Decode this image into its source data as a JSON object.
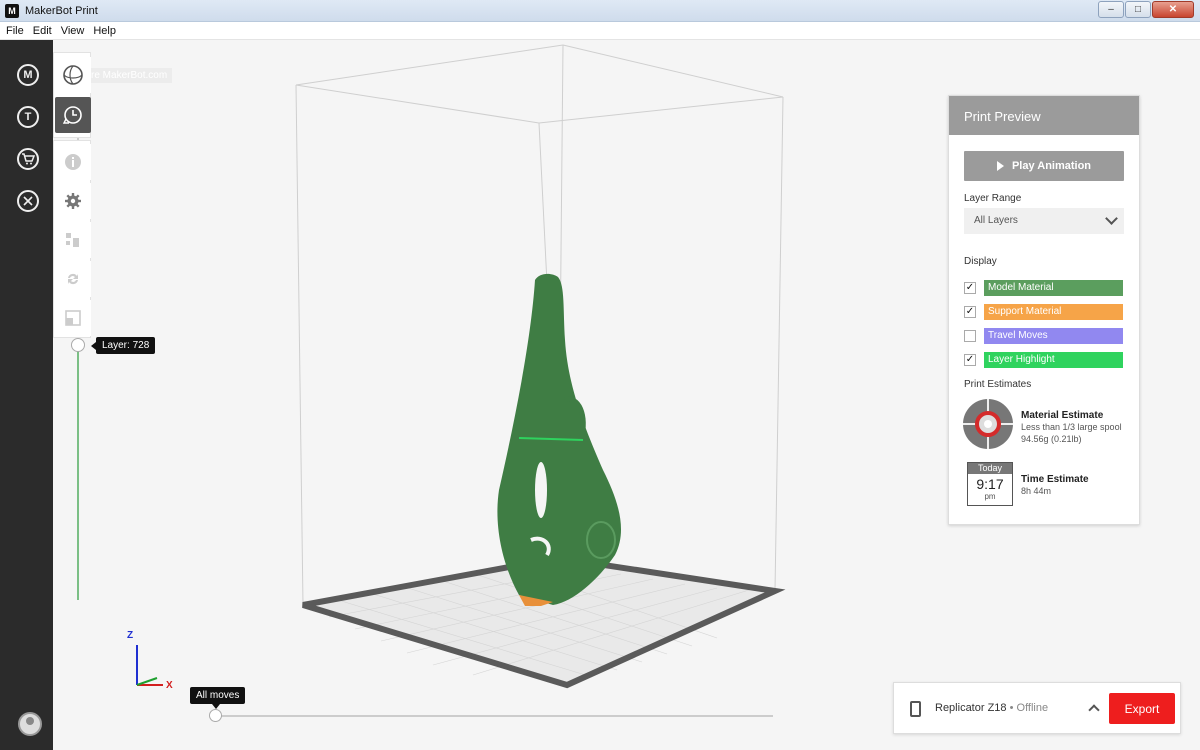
{
  "window": {
    "title": "MakerBot Print",
    "app_icon": "M",
    "min": "–",
    "max": "□",
    "close": "✕"
  },
  "menu": [
    "File",
    "Edit",
    "View",
    "Help"
  ],
  "rail": {
    "items": [
      "M",
      "T",
      "cart",
      "tools"
    ],
    "labels": [
      "M",
      "T",
      "🛒",
      "✂"
    ]
  },
  "viewport": {
    "faint_label": "Explore MakerBot.com",
    "layer_tooltip": "Layer: 728",
    "moves_tooltip": "All moves",
    "axis_z": "Z",
    "axis_x": "X",
    "layer_position": 0.5
  },
  "panel": {
    "title": "Print Preview",
    "play_label": "Play Animation",
    "layer_range_label": "Layer Range",
    "layer_range_value": "All Layers",
    "display_label": "Display",
    "display_items": [
      {
        "label": "Model Material",
        "checked": "✓",
        "color": "#5b9e5e"
      },
      {
        "label": "Support Material",
        "checked": "✓",
        "color": "#f6a448"
      },
      {
        "label": "Travel Moves",
        "checked": "",
        "color": "#9188f0"
      },
      {
        "label": "Layer Highlight",
        "checked": "✓",
        "color": "#2fd35e"
      }
    ],
    "estimates_label": "Print Estimates",
    "material_title": "Material Estimate",
    "material_line1": "Less than 1/3 large spool",
    "material_line2": "94.56g (0.21lb)",
    "calendar_head": "Today",
    "calendar_time": "9:17",
    "calendar_pm": "pm",
    "time_title": "Time Estimate",
    "time_value": "8h 44m"
  },
  "status": {
    "printer": "Replicator Z18",
    "separator": " • ",
    "state": "Offline",
    "export_label": "Export"
  },
  "colors": {
    "accent": "#ee1e1e",
    "model": "#3f7d44",
    "rail": "#2b2b2b"
  }
}
